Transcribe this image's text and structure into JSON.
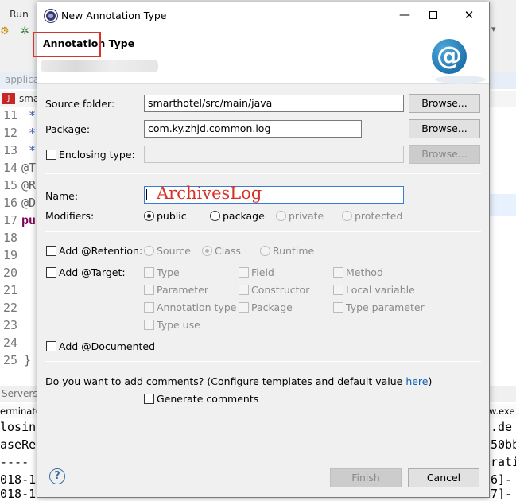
{
  "ide": {
    "menu_run": "Run",
    "tab_label": "applica",
    "editor_tab_label": "sma",
    "line_numbers": [
      "11",
      "12",
      "13",
      "14",
      "15",
      "16",
      "17",
      "18",
      "19",
      "20",
      "21",
      "22",
      "23",
      "24",
      "25"
    ],
    "code_fragments": [
      "*",
      "*",
      "*",
      "@T",
      "@R",
      "@D",
      "pu",
      "}"
    ],
    "bottom_tab": "Servers",
    "console_header_left": "erminate",
    "console_header_right": "w.exe",
    "console_left": [
      "losin",
      "aseRe",
      "----",
      "018-1",
      "018-1"
    ],
    "console_right": [
      ".de",
      "50bb",
      "rati",
      "6]-",
      "7]-"
    ]
  },
  "dialog": {
    "title": "New Annotation Type",
    "heading": "Annotation Type",
    "source_folder_label": "Source folder:",
    "source_folder_value": "smarthotel/src/main/java",
    "package_label": "Package:",
    "package_value": "com.ky.zhjd.common.log",
    "browse_label": "Browse...",
    "enclosing_type_label": "Enclosing type:",
    "enclosing_type_value": "",
    "name_label": "Name:",
    "name_value": "ArchivesLog",
    "modifiers_label": "Modifiers:",
    "modifiers": {
      "public": "public",
      "package": "package",
      "private": "private",
      "protected": "protected",
      "selected": "public"
    },
    "retention": {
      "label": "Add @Retention:",
      "source": "Source",
      "class": "Class",
      "runtime": "Runtime",
      "selected": "Class"
    },
    "target": {
      "label": "Add @Target:",
      "options": [
        "Type",
        "Field",
        "Method",
        "Parameter",
        "Constructor",
        "Local variable",
        "Annotation type",
        "Package",
        "Type parameter",
        "Type use"
      ]
    },
    "documented_label": "Add @Documented",
    "comments_question": "Do you want to add comments? (Configure templates and default value ",
    "comments_link": "here",
    "comments_close": ")",
    "generate_comments_label": "Generate comments",
    "finish_label": "Finish",
    "cancel_label": "Cancel",
    "help_glyph": "?",
    "colors": {
      "highlight_box": "#d9322a",
      "typed_text": "#d93025",
      "link": "#0b5fb0",
      "logo": "#1f74ad"
    },
    "logo_glyph": "@"
  }
}
